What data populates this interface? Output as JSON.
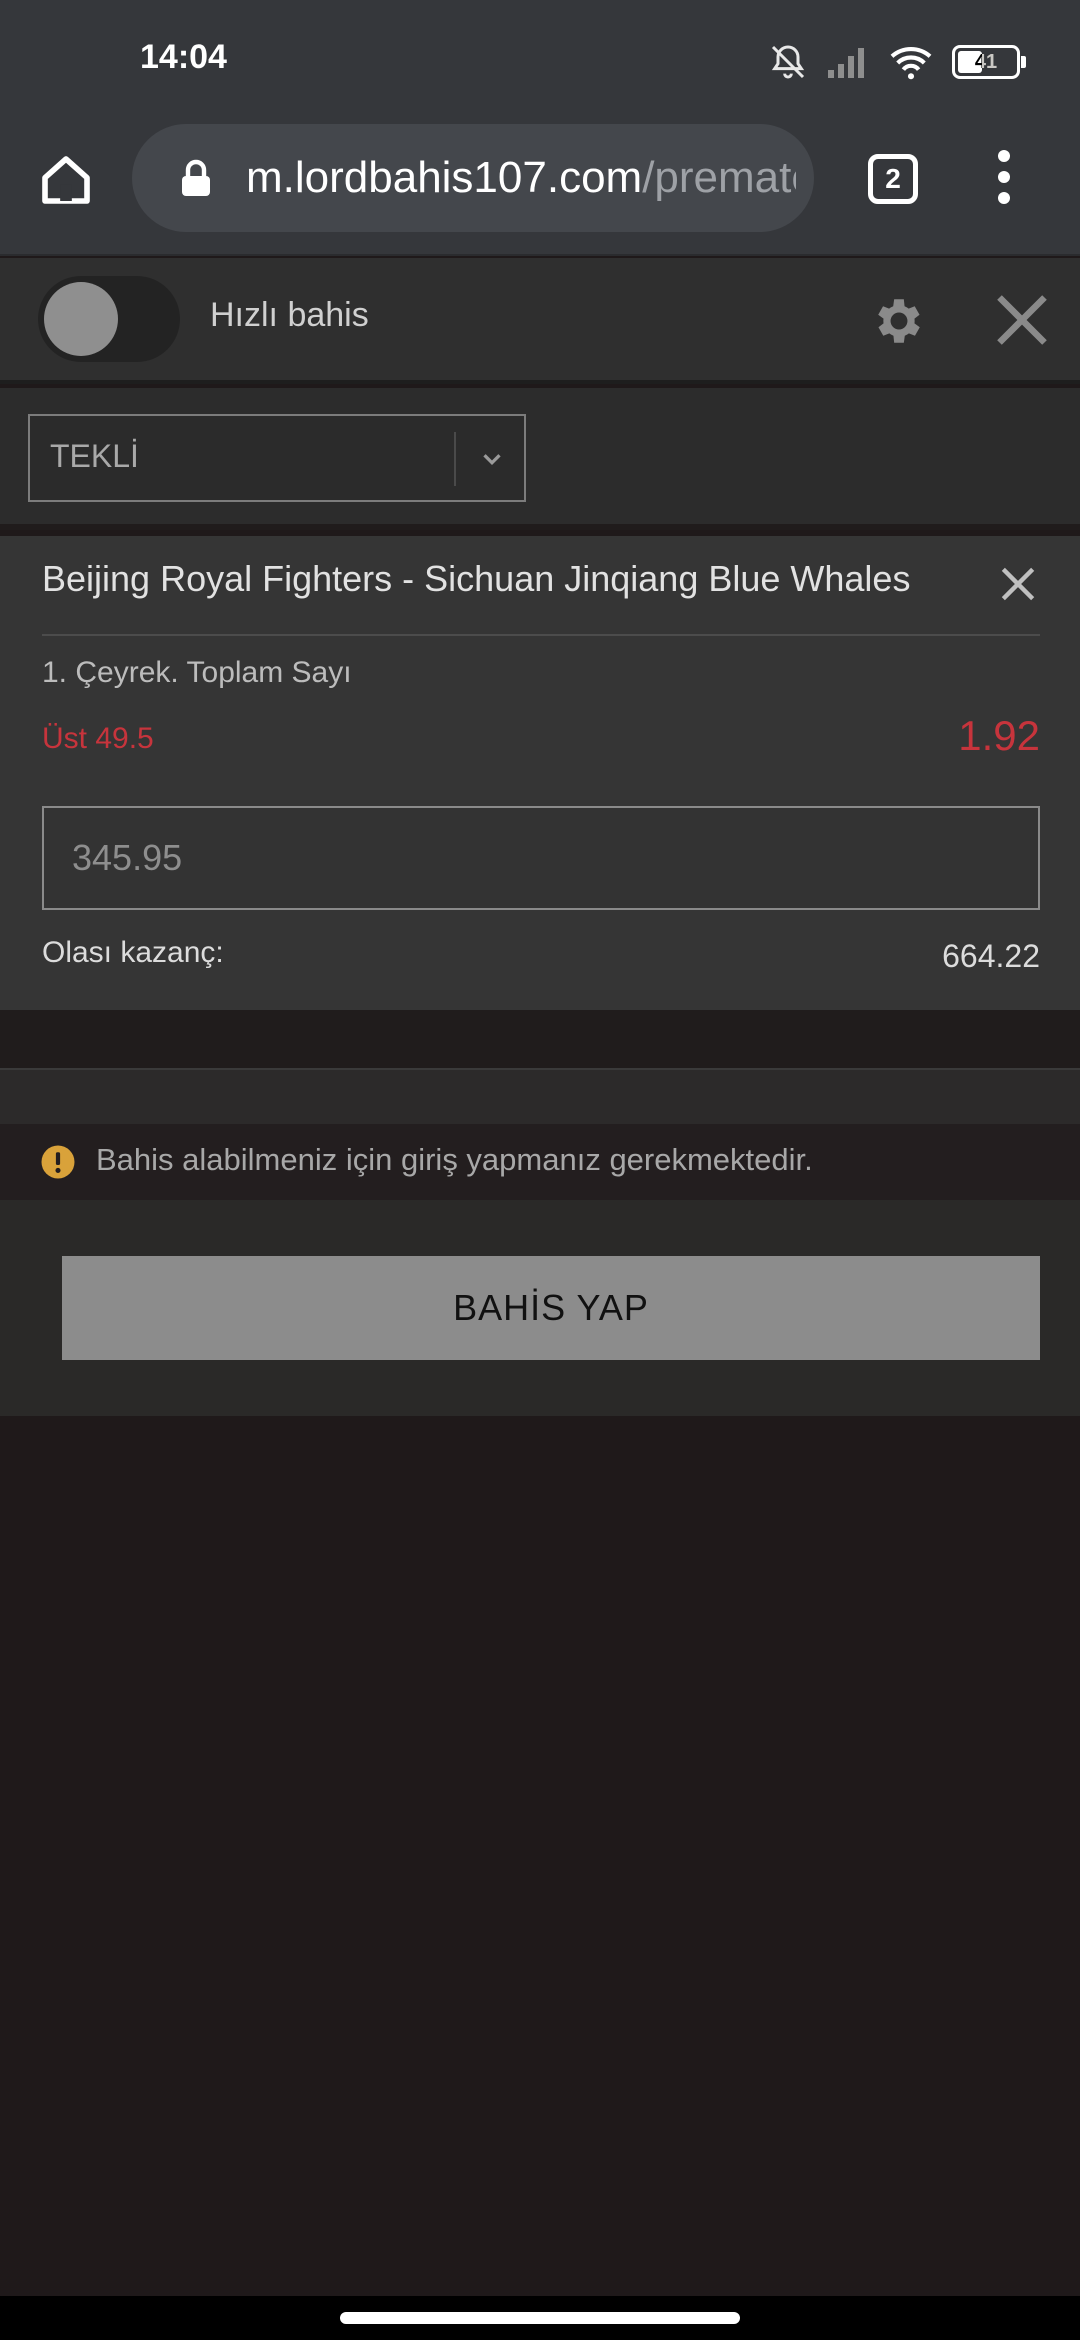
{
  "status_bar": {
    "time": "14:04",
    "battery": "41",
    "icons": [
      "bell-off-icon",
      "signal-icon",
      "wifi-icon",
      "battery-icon"
    ]
  },
  "browser": {
    "url_host": "m.lordbahis107.com",
    "url_path": "/prematch",
    "tab_count": "2"
  },
  "quick_bet": {
    "label": "Hızlı bahis",
    "enabled": false
  },
  "bet_type": {
    "selected": "TEKLİ"
  },
  "slip": {
    "match": "Beijing Royal Fighters - Sichuan Jinqiang Blue Whales",
    "market": "1. Çeyrek. Toplam Sayı",
    "selection": "Üst 49.5",
    "odds": "1.92",
    "stake_placeholder": "345.95",
    "win_label": "Olası kazanç:",
    "win_value": "664.22"
  },
  "warning": {
    "text": "Bahis alabilmeniz için giriş yapmanız gerekmektedir."
  },
  "actions": {
    "place_bet": "BAHİS YAP"
  },
  "colors": {
    "accent_red": "#c7343c",
    "warning_yellow": "#d9a23a",
    "button_grey": "#8c8c8c"
  }
}
